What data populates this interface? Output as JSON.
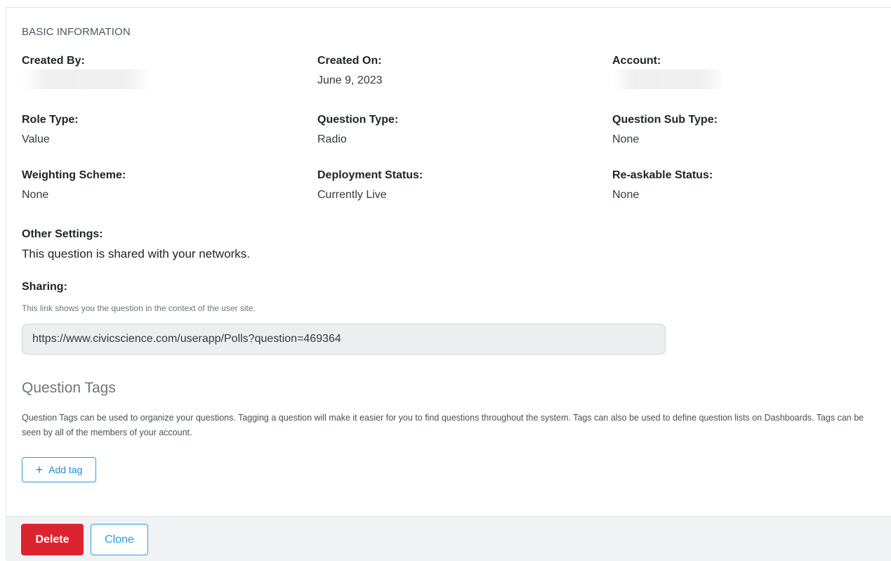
{
  "basic_info": {
    "section_title": "BASIC INFORMATION",
    "created_by": {
      "label": "Created By:",
      "value": ""
    },
    "created_on": {
      "label": "Created On:",
      "value": "June 9, 2023"
    },
    "account": {
      "label": "Account:",
      "value": ""
    },
    "role_type": {
      "label": "Role Type:",
      "value": "Value"
    },
    "question_type": {
      "label": "Question Type:",
      "value": "Radio"
    },
    "question_sub_type": {
      "label": "Question Sub Type:",
      "value": "None"
    },
    "weighting_scheme": {
      "label": "Weighting Scheme:",
      "value": "None"
    },
    "deployment_status": {
      "label": "Deployment Status:",
      "value": "Currently Live"
    },
    "reaskable_status": {
      "label": "Re-askable Status:",
      "value": "None"
    },
    "other_settings": {
      "label": "Other Settings:",
      "value": "This question is shared with your networks."
    }
  },
  "sharing": {
    "label": "Sharing:",
    "hint": "This link shows you the question in the context of the user site.",
    "url": "https://www.civicscience.com/userapp/Polls?question=469364"
  },
  "tags": {
    "title": "Question Tags",
    "description": "Question Tags can be used to organize your questions. Tagging a question will make it easier for you to find questions throughout the system. Tags can also be used to define question lists on Dashboards. Tags can be seen by all of the members of your account.",
    "add_label": "Add tag",
    "add_icon": "plus-icon"
  },
  "footer": {
    "delete_label": "Delete",
    "clone_label": "Clone"
  },
  "colors": {
    "primary": "#2d9cdb",
    "danger": "#dc2430"
  }
}
